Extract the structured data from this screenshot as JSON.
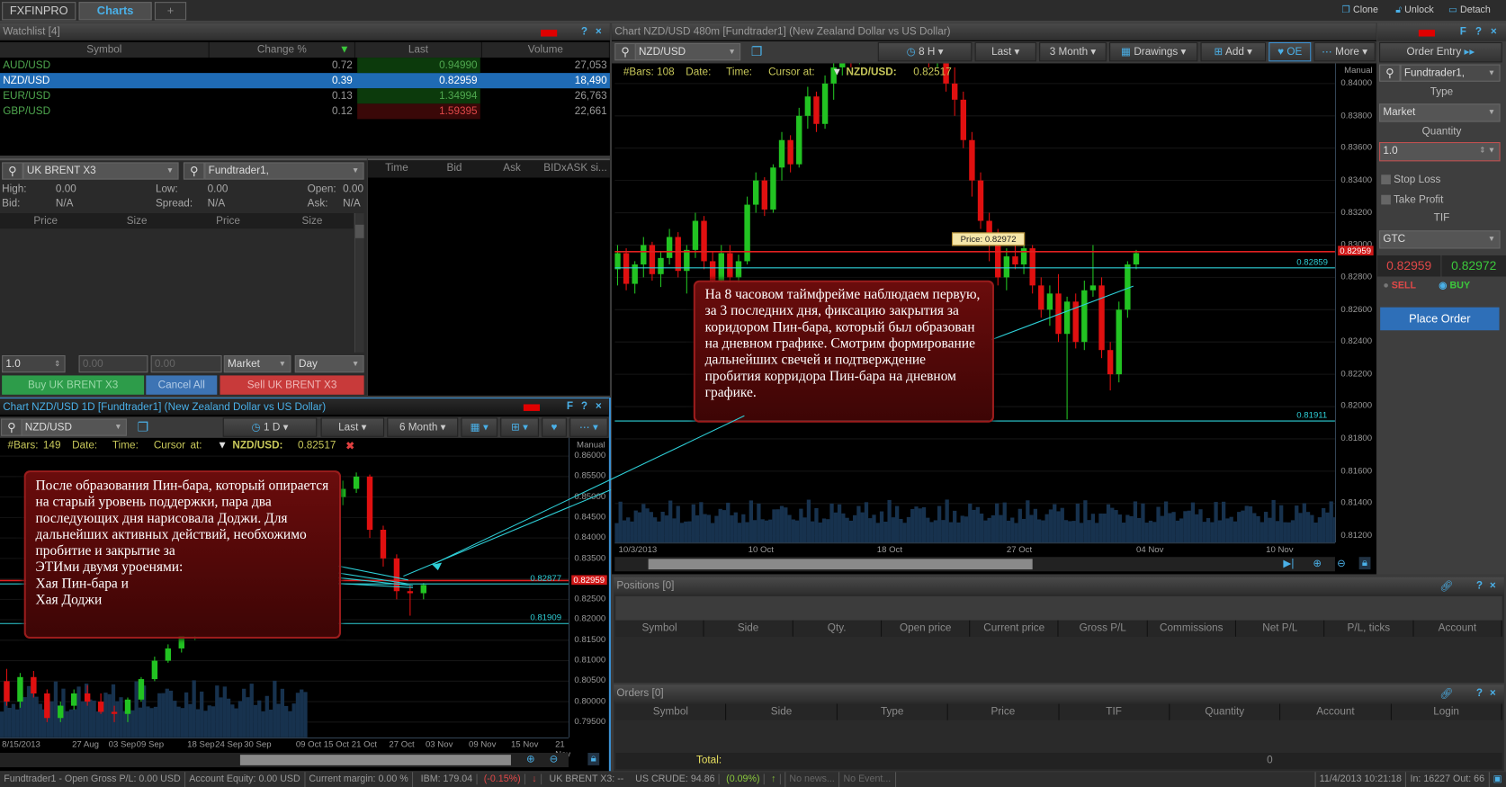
{
  "topbar": {
    "tabs": [
      "FXFINPRO",
      "Charts",
      "+"
    ],
    "actions": [
      "Clone",
      "Unlock",
      "Detach"
    ]
  },
  "watchlist": {
    "title": "Watchlist [4]",
    "columns": [
      "Symbol",
      "Change %",
      "Last",
      "Volume"
    ],
    "rows": [
      {
        "symbol": "AUD/USD",
        "change": "0.72",
        "last": "0.94990",
        "volume": "27,053",
        "dir": "up"
      },
      {
        "symbol": "NZD/USD",
        "change": "0.39",
        "last": "0.82959",
        "volume": "18,490",
        "dir": "sel"
      },
      {
        "symbol": "EUR/USD",
        "change": "0.13",
        "last": "1.34994",
        "volume": "26,763",
        "dir": "up"
      },
      {
        "symbol": "GBP/USD",
        "change": "0.12",
        "last": "1.59395",
        "volume": "22,661",
        "dir": "down"
      }
    ],
    "controls": [
      "?",
      "×"
    ]
  },
  "depth": {
    "symbol": "UK BRENT X3",
    "account": "Fundtrader1,",
    "high_label": "High:",
    "high": "0.00",
    "low_label": "Low:",
    "low": "0.00",
    "open_label": "Open:",
    "open": "0.00",
    "bid_label": "Bid:",
    "bid": "N/A",
    "spread_label": "Spread:",
    "spread": "N/A",
    "ask_label": "Ask:",
    "ask": "N/A",
    "columns": [
      "Price",
      "Size",
      "Price",
      "Size"
    ],
    "ts_columns": [
      "Time",
      "Bid",
      "Ask",
      "BIDxASK si..."
    ],
    "qty": "1.0",
    "price1": "0.00",
    "price2": "0.00",
    "type": "Market",
    "tif": "Day",
    "buy": "Buy UK BRENT X3",
    "cancel": "Cancel All",
    "sell": "Sell UK BRENT X3"
  },
  "chart_small": {
    "title": "Chart NZD/USD 1D [Fundtrader1] (New Zealand Dollar vs US Dollar)",
    "symbol": "NZD/USD",
    "interval": "1 D",
    "price_type": "Last",
    "range": "6 Month",
    "controls": [
      "F",
      "?",
      "×"
    ],
    "info": {
      "bars": "#Bars: 149",
      "date": "Date:",
      "time": "Time:",
      "cursor": "Cursor at:",
      "pair": "NZD/USD:",
      "value": "0.82517"
    },
    "manual": "Manual",
    "note": "После образования Пин-бара, который опирается на старый уровень поддержки, пара два последующих дня нарисовала Доджи. Для дальнейших активных действий, необхожимо пробитие и закрытие за\nЭТИми двумя уроенями:\nХая Пин-бара и\nХая Доджи"
  },
  "chart_main": {
    "title": "Chart NZD/USD 480m [Fundtrader1] (New Zealand Dollar vs US Dollar)",
    "symbol": "NZD/USD",
    "interval": "8 H",
    "price_type": "Last",
    "range": "3 Month",
    "drawings": "Drawings",
    "add": "Add",
    "oe": "OE",
    "more": "More",
    "controls": [
      "F",
      "?",
      "×"
    ],
    "info": {
      "bars": "#Bars: 108",
      "date": "Date:",
      "time": "Time:",
      "cursor": "Cursor at:",
      "pair": "NZD/USD:",
      "value": "0.82517"
    },
    "manual": "Manual",
    "tooltip": "Price: 0.82972",
    "note": "На 8 часовом таймфрейме наблюдаем первую, за 3 последних дня, фиксацию закрытия за коридором Пин-бара, который был образован на дневном графике. Смотрим формирование дальнейших свечей и подтверждение пробития корридора Пин-бара на дневном графике."
  },
  "order_entry": {
    "title": "Order Entry",
    "account": "Fundtrader1,",
    "type_label": "Type",
    "type": "Market",
    "qty_label": "Quantity",
    "qty": "1.0",
    "stop_loss": "Stop Loss",
    "take_profit": "Take Profit",
    "tif_label": "TIF",
    "tif": "GTC",
    "bid": "0.82959",
    "ask": "0.82972",
    "sell": "SELL",
    "buy": "BUY",
    "place": "Place Order"
  },
  "positions": {
    "title": "Positions [0]",
    "columns": [
      "Symbol",
      "Side",
      "Qty.",
      "Open price",
      "Current price",
      "Gross P/L",
      "Commissions",
      "Net P/L",
      "P/L, ticks",
      "Account"
    ]
  },
  "orders": {
    "title": "Orders [0]",
    "columns": [
      "Symbol",
      "Side",
      "Type",
      "Price",
      "TIF",
      "Quantity",
      "Account",
      "Login"
    ],
    "total_label": "Total:",
    "total": "0"
  },
  "statusbar": {
    "account": "Fundtrader1 - Open Gross  P/L: 0.00 USD",
    "equity": "Account Equity: 0.00 USD",
    "margin": "Current margin: 0.00 %",
    "ibm": "IBM: 179.04",
    "ibm_chg": "(-0.15%)",
    "brent": "UK BRENT X3: --",
    "crude": "US CRUDE: 94.86",
    "crude_chg": "(0.09%)",
    "news": "No news...",
    "events": "No Event...",
    "datetime": "11/4/2013 10:21:18",
    "io": "In: 16227 Out: 66"
  },
  "colors": {
    "up": "#22c322",
    "down": "#e01010",
    "accent": "#4ab0e8",
    "level": "#2ed0d8",
    "price_line": "#e02020"
  },
  "chart_data": [
    {
      "type": "candlestick",
      "name": "NZD/USD 8H",
      "ylim": [
        0.812,
        0.84
      ],
      "yticks": [
        "0.84000",
        "0.83800",
        "0.83600",
        "0.83400",
        "0.83200",
        "0.83000",
        "0.82800",
        "0.82600",
        "0.82400",
        "0.82200",
        "0.82000",
        "0.81800",
        "0.81600",
        "0.81400",
        "0.81200"
      ],
      "xticks": [
        "10/3/2013",
        "10 Oct",
        "18 Oct",
        "27 Oct",
        "04 Nov",
        "10 Nov"
      ],
      "levels": [
        {
          "value": 0.82959,
          "label": "0.82959",
          "kind": "price"
        },
        {
          "value": 0.82859,
          "label": "0.82859",
          "kind": "level"
        },
        {
          "value": 0.81911,
          "label": "0.81911",
          "kind": "level"
        }
      ],
      "ohlc": [
        [
          0.8285,
          0.83,
          0.8275,
          0.8295
        ],
        [
          0.8295,
          0.8298,
          0.8272,
          0.8276
        ],
        [
          0.8276,
          0.829,
          0.827,
          0.8288
        ],
        [
          0.8288,
          0.8305,
          0.828,
          0.83
        ],
        [
          0.83,
          0.8302,
          0.8278,
          0.8282
        ],
        [
          0.8282,
          0.8296,
          0.8274,
          0.8292
        ],
        [
          0.8292,
          0.831,
          0.8288,
          0.8305
        ],
        [
          0.8305,
          0.8308,
          0.828,
          0.8284
        ],
        [
          0.8284,
          0.83,
          0.827,
          0.8297
        ],
        [
          0.8297,
          0.832,
          0.8292,
          0.8315
        ],
        [
          0.8315,
          0.8318,
          0.8285,
          0.829
        ],
        [
          0.829,
          0.8296,
          0.8272,
          0.8278
        ],
        [
          0.8278,
          0.83,
          0.8275,
          0.8295
        ],
        [
          0.8295,
          0.83,
          0.8276,
          0.828
        ],
        [
          0.828,
          0.8294,
          0.827,
          0.829
        ],
        [
          0.829,
          0.833,
          0.8288,
          0.8325
        ],
        [
          0.8325,
          0.8345,
          0.832,
          0.834
        ],
        [
          0.834,
          0.8342,
          0.8318,
          0.8322
        ],
        [
          0.8322,
          0.835,
          0.832,
          0.8348
        ],
        [
          0.8348,
          0.837,
          0.834,
          0.8365
        ],
        [
          0.8365,
          0.8368,
          0.8345,
          0.835
        ],
        [
          0.835,
          0.8385,
          0.8348,
          0.838
        ],
        [
          0.838,
          0.8398,
          0.8372,
          0.8392
        ],
        [
          0.8392,
          0.8395,
          0.837,
          0.8375
        ],
        [
          0.8375,
          0.8405,
          0.8372,
          0.84
        ],
        [
          0.84,
          0.8415,
          0.839,
          0.841
        ],
        [
          0.841,
          0.8425,
          0.8405,
          0.842
        ],
        [
          0.842,
          0.843,
          0.841,
          0.8415
        ],
        [
          0.8415,
          0.844,
          0.8412,
          0.8435
        ],
        [
          0.8435,
          0.8445,
          0.842,
          0.8425
        ],
        [
          0.8425,
          0.845,
          0.842,
          0.8445
        ],
        [
          0.8445,
          0.8455,
          0.843,
          0.8435
        ],
        [
          0.8435,
          0.844,
          0.842,
          0.843
        ],
        [
          0.843,
          0.845,
          0.8425,
          0.8445
        ],
        [
          0.8445,
          0.845,
          0.8425,
          0.843
        ],
        [
          0.843,
          0.844,
          0.8415,
          0.8435
        ],
        [
          0.8435,
          0.844,
          0.841,
          0.8415
        ],
        [
          0.8415,
          0.843,
          0.841,
          0.842
        ],
        [
          0.842,
          0.8425,
          0.8395,
          0.84
        ],
        [
          0.84,
          0.841,
          0.838,
          0.839
        ],
        [
          0.839,
          0.8395,
          0.836,
          0.8365
        ],
        [
          0.8365,
          0.837,
          0.833,
          0.834
        ],
        [
          0.834,
          0.8345,
          0.831,
          0.8315
        ],
        [
          0.8315,
          0.832,
          0.829,
          0.83
        ],
        [
          0.83,
          0.831,
          0.8275,
          0.828
        ],
        [
          0.828,
          0.8298,
          0.8272,
          0.8293
        ],
        [
          0.8293,
          0.83,
          0.8285,
          0.8288
        ],
        [
          0.8288,
          0.8305,
          0.8282,
          0.8298
        ],
        [
          0.8298,
          0.83,
          0.827,
          0.8275
        ],
        [
          0.8275,
          0.828,
          0.8255,
          0.826
        ],
        [
          0.826,
          0.8275,
          0.825,
          0.827
        ],
        [
          0.827,
          0.8282,
          0.824,
          0.8245
        ],
        [
          0.8245,
          0.8268,
          0.8192,
          0.8265
        ],
        [
          0.8265,
          0.827,
          0.8236,
          0.824
        ],
        [
          0.824,
          0.8278,
          0.8235,
          0.8272
        ],
        [
          0.8272,
          0.83,
          0.8268,
          0.8275
        ],
        [
          0.8275,
          0.828,
          0.823,
          0.8235
        ],
        [
          0.8235,
          0.824,
          0.821,
          0.822
        ],
        [
          0.822,
          0.8265,
          0.8215,
          0.826
        ],
        [
          0.826,
          0.829,
          0.8255,
          0.8288
        ],
        [
          0.8288,
          0.8297,
          0.8285,
          0.8295
        ]
      ]
    },
    {
      "type": "candlestick",
      "name": "NZD/USD 1D",
      "ylim": [
        0.795,
        0.86
      ],
      "yticks": [
        "0.86000",
        "0.85500",
        "0.85000",
        "0.84500",
        "0.84000",
        "0.83500",
        "0.83000",
        "0.82500",
        "0.82000",
        "0.81500",
        "0.81000",
        "0.80500",
        "0.80000",
        "0.79500"
      ],
      "xticks": [
        "8/15/2013",
        "27 Aug",
        "03 Sep",
        "09 Sep",
        "18 Sep",
        "24 Sep",
        "30 Sep",
        "09 Oct",
        "15 Oct",
        "21 Oct",
        "27 Oct",
        "03 Nov",
        "09 Nov",
        "15 Nov",
        "21 Nov"
      ],
      "levels": [
        {
          "value": 0.82959,
          "label": "0.82959",
          "kind": "price"
        },
        {
          "value": 0.82877,
          "label": "0.82877",
          "kind": "level"
        },
        {
          "value": 0.81909,
          "label": "0.81909",
          "kind": "level"
        }
      ],
      "ohlc": [
        [
          0.805,
          0.808,
          0.799,
          0.8
        ],
        [
          0.8,
          0.807,
          0.7985,
          0.806
        ],
        [
          0.806,
          0.8075,
          0.801,
          0.802
        ],
        [
          0.802,
          0.803,
          0.795,
          0.796
        ],
        [
          0.796,
          0.8,
          0.795,
          0.799
        ],
        [
          0.799,
          0.803,
          0.798,
          0.802
        ],
        [
          0.802,
          0.804,
          0.799,
          0.8
        ],
        [
          0.8,
          0.802,
          0.797,
          0.7975
        ],
        [
          0.7975,
          0.799,
          0.795,
          0.797
        ],
        [
          0.797,
          0.801,
          0.795,
          0.8005
        ],
        [
          0.8005,
          0.806,
          0.8,
          0.8055
        ],
        [
          0.8055,
          0.811,
          0.805,
          0.81
        ],
        [
          0.81,
          0.814,
          0.8095,
          0.813
        ],
        [
          0.813,
          0.817,
          0.812,
          0.816
        ],
        [
          0.816,
          0.82,
          0.815,
          0.819
        ],
        [
          0.819,
          0.823,
          0.818,
          0.822
        ],
        [
          0.822,
          0.826,
          0.821,
          0.825
        ],
        [
          0.825,
          0.827,
          0.823,
          0.824
        ],
        [
          0.824,
          0.83,
          0.8235,
          0.829
        ],
        [
          0.829,
          0.834,
          0.828,
          0.833
        ],
        [
          0.833,
          0.837,
          0.832,
          0.836
        ],
        [
          0.836,
          0.84,
          0.835,
          0.839
        ],
        [
          0.839,
          0.843,
          0.838,
          0.842
        ],
        [
          0.842,
          0.846,
          0.841,
          0.845
        ],
        [
          0.845,
          0.849,
          0.844,
          0.848
        ],
        [
          0.85,
          0.854,
          0.848,
          0.852
        ],
        [
          0.852,
          0.856,
          0.851,
          0.855
        ],
        [
          0.855,
          0.8555,
          0.84,
          0.842
        ],
        [
          0.842,
          0.843,
          0.833,
          0.835
        ],
        [
          0.835,
          0.836,
          0.825,
          0.827
        ],
        [
          0.827,
          0.8285,
          0.821,
          0.8265
        ],
        [
          0.8265,
          0.829,
          0.825,
          0.8285
        ]
      ]
    }
  ]
}
